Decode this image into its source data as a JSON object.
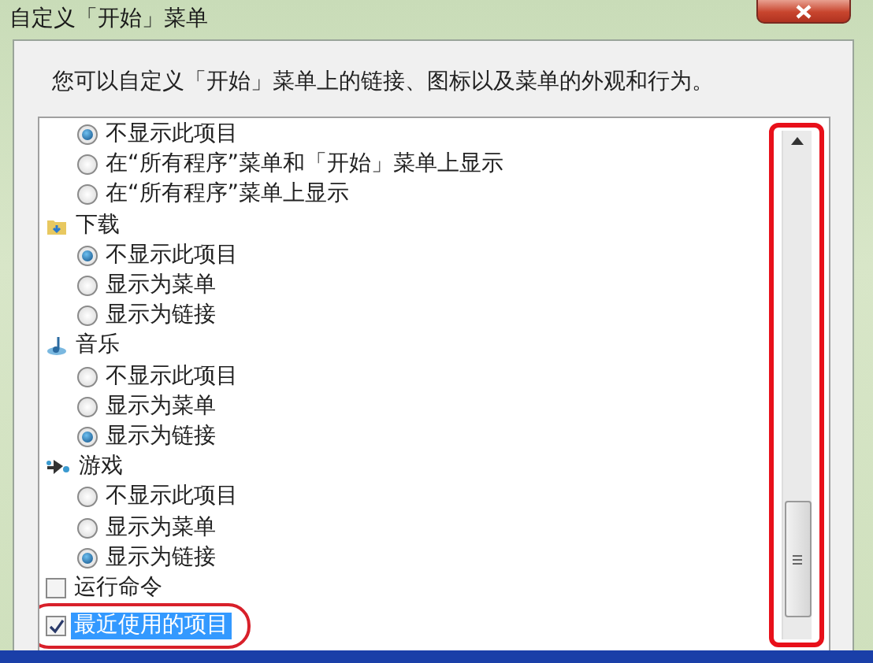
{
  "window": {
    "title": "自定义「开始」菜单"
  },
  "description": "您可以自定义「开始」菜单上的链接、图标以及菜单的外观和行为。",
  "items": [
    {
      "kind": "radio",
      "label": "不显示此项目",
      "selected": true
    },
    {
      "kind": "radio",
      "label": "在“所有程序”菜单和「开始」菜单上显示",
      "selected": false
    },
    {
      "kind": "radio",
      "label": "在“所有程序”菜单上显示",
      "selected": false
    },
    {
      "kind": "heading",
      "label": "下载"
    },
    {
      "kind": "radio",
      "label": "不显示此项目",
      "selected": true
    },
    {
      "kind": "radio",
      "label": "显示为菜单",
      "selected": false
    },
    {
      "kind": "radio",
      "label": "显示为链接",
      "selected": false
    },
    {
      "kind": "heading",
      "label": "音乐"
    },
    {
      "kind": "radio",
      "label": "不显示此项目",
      "selected": false
    },
    {
      "kind": "radio",
      "label": "显示为菜单",
      "selected": false
    },
    {
      "kind": "radio",
      "label": "显示为链接",
      "selected": true
    },
    {
      "kind": "heading",
      "label": "游戏"
    },
    {
      "kind": "radio",
      "label": "不显示此项目",
      "selected": false
    },
    {
      "kind": "radio",
      "label": "显示为菜单",
      "selected": false
    },
    {
      "kind": "radio",
      "label": "显示为链接",
      "selected": true
    },
    {
      "kind": "checkbox",
      "label": "运行命令",
      "checked": false,
      "selected": false
    },
    {
      "kind": "checkbox",
      "label": "最近使用的项目",
      "checked": true,
      "selected": true
    }
  ]
}
